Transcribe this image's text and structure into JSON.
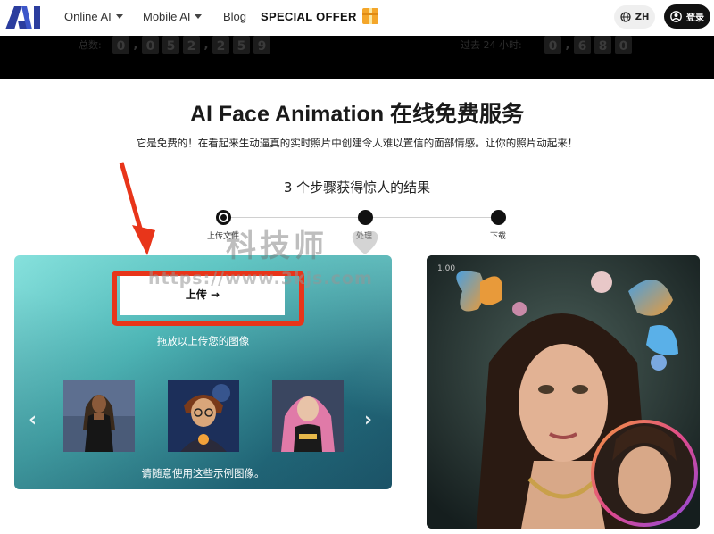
{
  "nav": {
    "logo_text": "AI",
    "items": [
      {
        "label": "Online AI"
      },
      {
        "label": "Mobile AI"
      },
      {
        "label": "Blog"
      }
    ],
    "special_offer": "SPECIAL OFFER",
    "lang": "ZH",
    "login": "登录"
  },
  "counters": [
    {
      "label": "总数:",
      "digits": [
        "0",
        ",",
        "0",
        "5",
        "2",
        ",",
        "2",
        "5",
        "9"
      ]
    },
    {
      "label": "过去 24 小时:",
      "digits": [
        "0",
        ",",
        "6",
        "8",
        "0"
      ]
    }
  ],
  "hero": {
    "title": "AI Face Animation 在线免费服务",
    "subtitle": "它是免费的！在看起来生动逼真的实时照片中创建令人难以置信的面部情感。让你的照片动起来！",
    "steps_title": "3 个步骤获得惊人的结果"
  },
  "steps": [
    {
      "label": "上传文件"
    },
    {
      "label": "处理"
    },
    {
      "label": "下载"
    }
  ],
  "upload": {
    "button": "上传 →",
    "drop_hint": "拖放以上传您的图像",
    "sample_note": "请随意使用这些示例图像。",
    "prev": "‹",
    "next": "›"
  },
  "preview": {
    "time": "1.00"
  },
  "watermark": {
    "text": "科技师",
    "url": "https://www.3kjs.com"
  },
  "colors": {
    "accent_red": "#e8351a",
    "brand_blue": "#2b3d9e",
    "panel_teal": "#4fb7b7"
  }
}
